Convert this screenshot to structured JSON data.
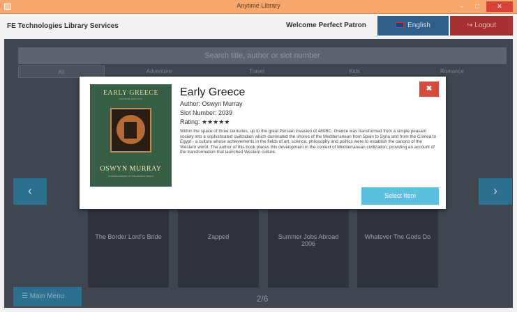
{
  "window": {
    "title": "Anytime Library",
    "min_label": "–",
    "max_label": "□",
    "close_label": "✕"
  },
  "header": {
    "brand": "FE Technologies Library Services",
    "welcome": "Welcome Perfect Patron",
    "language_label": "English",
    "logout_label": "Logout",
    "logout_icon": "↪"
  },
  "search": {
    "placeholder": "Search title, author or slot number"
  },
  "tabs": [
    "All",
    "Adventure",
    "Travel",
    "Kids",
    "Romance"
  ],
  "nav": {
    "prev": "‹",
    "next": "›"
  },
  "books": [
    "The Border Lord's Bride",
    "Zapped",
    "Summer Jobs Abroad 2006",
    "Whatever The Gods Do"
  ],
  "footer": {
    "menu_label": "Main Menu",
    "menu_icon": "☰",
    "page": "2/6"
  },
  "modal": {
    "cover": {
      "title": "EARLY GREECE",
      "subtitle": "SECOND EDITION",
      "author": "OSWYN MURRAY",
      "series": "FONTANA HISTORY OF THE ANCIENT WORLD"
    },
    "title": "Early Greece",
    "author_line": "Author: Oswyn Murray",
    "slot_line": "Slot Number: 2039",
    "rating_label": "Rating:",
    "rating_stars": "★★★★★",
    "rating_value": 5,
    "description": "Within the space of three centuries, up to the great Persian invasion of 480BC, Greece was transformed from a simple peasant society into a sophisticated civilization which dominated the shores of the Mediterranean from Spain to Syria and from the Crimea to Egypt - a culture whose achievements in the fields of art, science, philosophy and politics were to establish the canons of the Western world. The author of this book places this development in the context of Mediterranean civilization, providing an account of the transformation that launched Western culture.",
    "close_label": "✖",
    "select_label": "Select Item"
  }
}
